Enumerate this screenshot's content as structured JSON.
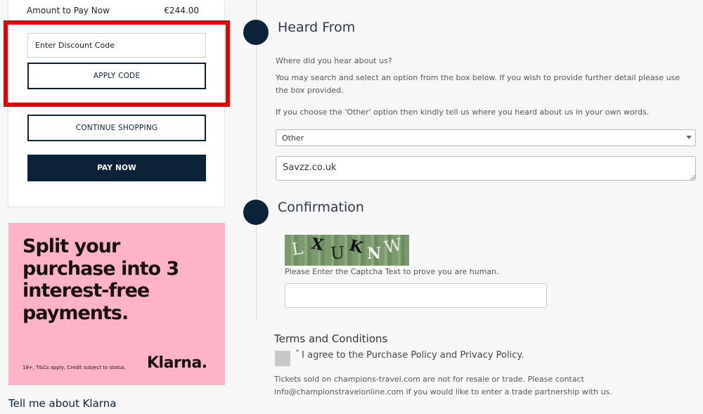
{
  "summary": {
    "amount_label": "Amount to Pay Now",
    "amount_value": "€244.00",
    "discount_placeholder": "Enter Discount Code",
    "apply_label": "APPLY CODE",
    "continue_label": "CONTINUE SHOPPING",
    "pay_label": "PAY NOW"
  },
  "klarna": {
    "headline": "Split your purchase into 3 interest-free payments.",
    "fine_print": "18+, T&Cs apply, Credit subject to status.",
    "logo": "Klarna.",
    "link": "Tell me about Klarna"
  },
  "heard_from": {
    "title": "Heard From",
    "question": "Where did you hear about us?",
    "instructions": "You may search and select an option from the box below. If you wish to provide further detail please use the box provided.",
    "other_note": "If you choose the 'Other' option then kindly tell us where you heard about us in your own words.",
    "selected_option": "Other",
    "detail_value": "Savzz.co.uk"
  },
  "confirmation": {
    "title": "Confirmation",
    "captcha_chars": [
      "L",
      "X",
      "U",
      "K",
      "N",
      "W"
    ],
    "captcha_hint": "Please Enter the Captcha Text to prove you are human."
  },
  "terms": {
    "title": "Terms and Conditions",
    "required_mark": "*",
    "agree_text": "I agree to the Purchase Policy and Privacy Policy.",
    "resale_note": "Tickets sold on champions-travel.com are not for resale or trade. Please contact info@championstravelonline.com if you would like to enter a trade partnership with us."
  },
  "colors": {
    "navy": "#0b2238",
    "highlight": "#e60000",
    "klarna_pink": "#ffb3c7"
  }
}
